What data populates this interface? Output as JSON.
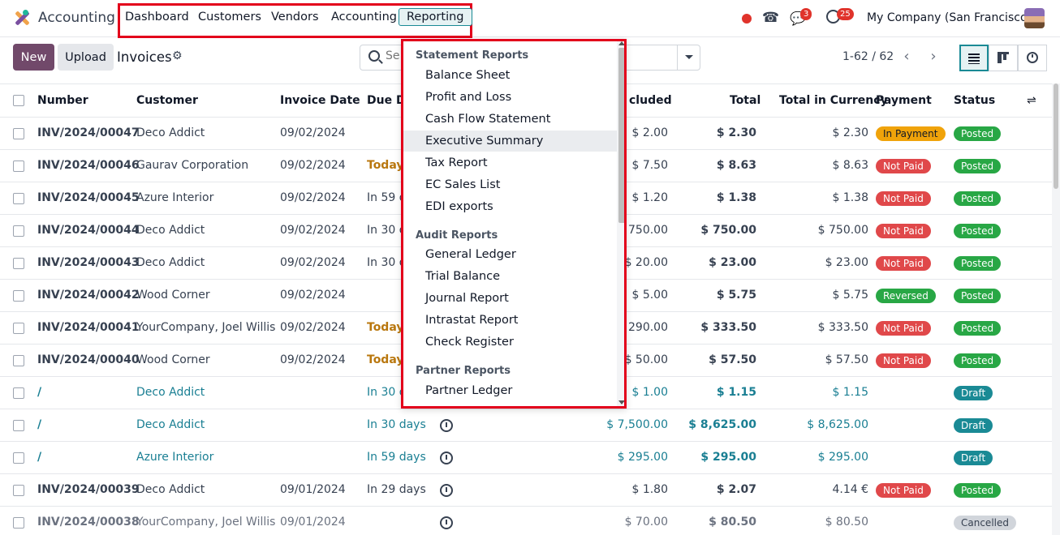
{
  "app": {
    "name": "Accounting"
  },
  "menu": {
    "dashboard": "Dashboard",
    "customers": "Customers",
    "vendors": "Vendors",
    "accounting": "Accounting",
    "reporting": "Reporting"
  },
  "systray": {
    "chat_count": "3",
    "activity_count": "25",
    "company": "My Company (San Francisco)"
  },
  "control": {
    "new_label": "New",
    "upload_label": "Upload",
    "breadcrumb": "Invoices",
    "search_placeholder": "Se",
    "pager": "1-62 / 62"
  },
  "columns": {
    "number": "Number",
    "customer": "Customer",
    "invoice_date": "Invoice Date",
    "due_date": "Due D",
    "tax_excluded": "cluded",
    "total": "Total",
    "total_currency": "Total in Currency",
    "payment": "Payment",
    "status": "Status"
  },
  "rows": [
    {
      "number": "INV/2024/00047",
      "customer": "Deco Addict",
      "date": "09/02/2024",
      "due": "",
      "tax_excl": "$ 2.00",
      "total": "$ 2.30",
      "currency": "$ 2.30",
      "payment": "In Payment",
      "status": "Posted"
    },
    {
      "number": "INV/2024/00046",
      "customer": "Gaurav Corporation",
      "date": "09/02/2024",
      "due": "Today",
      "tax_excl": "$ 7.50",
      "total": "$ 8.63",
      "currency": "$ 8.63",
      "payment": "Not Paid",
      "status": "Posted"
    },
    {
      "number": "INV/2024/00045",
      "customer": "Azure Interior",
      "date": "09/02/2024",
      "due": "In 59 d",
      "tax_excl": "$ 1.20",
      "total": "$ 1.38",
      "currency": "$ 1.38",
      "payment": "Not Paid",
      "status": "Posted"
    },
    {
      "number": "INV/2024/00044",
      "customer": "Deco Addict",
      "date": "09/02/2024",
      "due": "In 30 d",
      "tax_excl": "750.00",
      "total": "$ 750.00",
      "currency": "$ 750.00",
      "payment": "Not Paid",
      "status": "Posted"
    },
    {
      "number": "INV/2024/00043",
      "customer": "Deco Addict",
      "date": "09/02/2024",
      "due": "In 30 d",
      "tax_excl": "$ 20.00",
      "total": "$ 23.00",
      "currency": "$ 23.00",
      "payment": "Not Paid",
      "status": "Posted"
    },
    {
      "number": "INV/2024/00042",
      "customer": "Wood Corner",
      "date": "09/02/2024",
      "due": "",
      "tax_excl": "$ 5.00",
      "total": "$ 5.75",
      "currency": "$ 5.75",
      "payment": "Reversed",
      "status": "Posted"
    },
    {
      "number": "INV/2024/00041",
      "customer": "YourCompany, Joel Willis",
      "date": "09/02/2024",
      "due": "Today",
      "tax_excl": "290.00",
      "total": "$ 333.50",
      "currency": "$ 333.50",
      "payment": "Not Paid",
      "status": "Posted"
    },
    {
      "number": "INV/2024/00040",
      "customer": "Wood Corner",
      "date": "09/02/2024",
      "due": "Today",
      "tax_excl": "$ 50.00",
      "total": "$ 57.50",
      "currency": "$ 57.50",
      "payment": "Not Paid",
      "status": "Posted"
    },
    {
      "number": "/",
      "customer": "Deco Addict",
      "date": "",
      "due": "In 30 d",
      "tax_excl": "$ 1.00",
      "total": "$ 1.15",
      "currency": "$ 1.15",
      "payment": "",
      "status": "Draft"
    },
    {
      "number": "/",
      "customer": "Deco Addict",
      "date": "",
      "due": "In 30 days",
      "tax_excl": "$ 7,500.00",
      "total": "$ 8,625.00",
      "currency": "$ 8,625.00",
      "payment": "",
      "status": "Draft"
    },
    {
      "number": "/",
      "customer": "Azure Interior",
      "date": "",
      "due": "In 59 days",
      "tax_excl": "$ 295.00",
      "total": "$ 295.00",
      "currency": "$ 295.00",
      "payment": "",
      "status": "Draft"
    },
    {
      "number": "INV/2024/00039",
      "customer": "Deco Addict",
      "date": "09/01/2024",
      "due": "In 29 days",
      "tax_excl": "$ 1.80",
      "total": "$ 2.07",
      "currency": "4.14 €",
      "payment": "Not Paid",
      "status": "Posted"
    },
    {
      "number": "INV/2024/00038",
      "customer": "YourCompany, Joel Willis",
      "date": "09/01/2024",
      "due": "",
      "tax_excl": "$ 70.00",
      "total": "$ 80.50",
      "currency": "$ 80.50",
      "payment": "",
      "status": "Cancelled"
    }
  ],
  "reporting_menu": {
    "statement_header": "Statement Reports",
    "balance_sheet": "Balance Sheet",
    "profit_loss": "Profit and Loss",
    "cash_flow": "Cash Flow Statement",
    "executive_summary": "Executive Summary",
    "tax_report": "Tax Report",
    "ec_sales": "EC Sales List",
    "edi_exports": "EDI exports",
    "audit_header": "Audit Reports",
    "general_ledger": "General Ledger",
    "trial_balance": "Trial Balance",
    "journal_report": "Journal Report",
    "intrastat": "Intrastat Report",
    "check_register": "Check Register",
    "partner_header": "Partner Reports",
    "partner_ledger": "Partner Ledger"
  },
  "colors": {
    "brand": "#71496a",
    "in_payment": "#f0a30a",
    "not_paid": "#e0484a",
    "reversed": "#28a745",
    "posted": "#28a745",
    "draft": "#1a8a95",
    "cancelled": "#d1d5db",
    "highlight_border": "#e3001b"
  },
  "icons": {
    "record": "record-dot-icon",
    "phone": "phone-icon",
    "chat": "chat-icon",
    "activity": "clock-icon",
    "gear": "gear-icon",
    "search": "search-icon"
  }
}
